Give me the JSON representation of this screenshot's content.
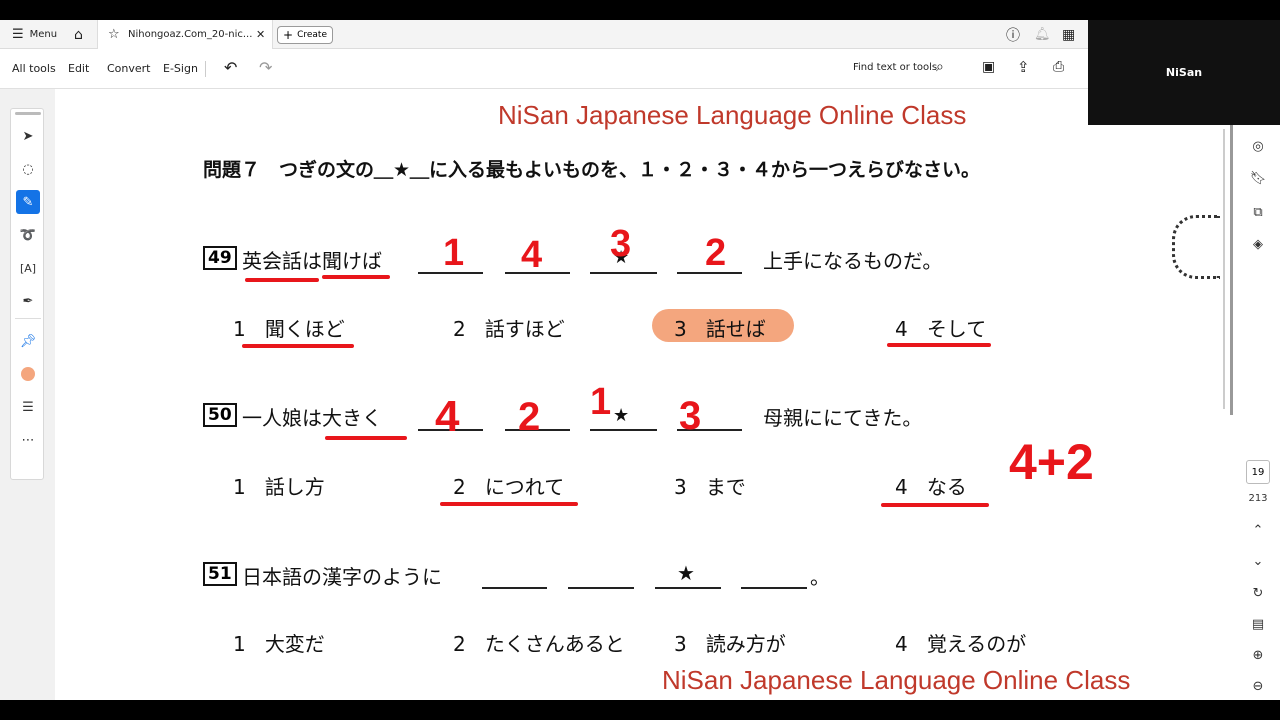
{
  "tabbar": {
    "menu_label": "Menu",
    "tab_title": "Nihongoaz.Com_20-nic...",
    "create_label": "Create"
  },
  "toolbar": {
    "all_tools": "All tools",
    "edit": "Edit",
    "convert": "Convert",
    "esign": "E-Sign",
    "find_label": "Find text or tools"
  },
  "video": {
    "name": "NiSan"
  },
  "pager": {
    "current_page": "19",
    "total_pages": "213"
  },
  "doc": {
    "watermark_top": "NiSan Japanese Language Online Class",
    "watermark_bottom": "NiSan Japanese Language Online Class",
    "instruction": "問題７　つぎの文の＿★＿に入る最もよいものを、１・２・３・４から一つえらびなさい。",
    "questions": [
      {
        "number": "49",
        "before": "英会話は聞けば",
        "star_mark": "★",
        "after": "上手になるものだ。",
        "handwritten": [
          "1",
          "4",
          "3",
          "2"
        ],
        "options": [
          {
            "num": "1",
            "text": "聞くほど"
          },
          {
            "num": "2",
            "text": "話すほど"
          },
          {
            "num": "3",
            "text": "話せば"
          },
          {
            "num": "4",
            "text": "そして"
          }
        ]
      },
      {
        "number": "50",
        "before": "一人娘は大きく",
        "star_mark": "★",
        "after": "母親ににてきた。",
        "handwritten": [
          "4",
          "2",
          "1",
          "3"
        ],
        "note": "4+2",
        "options": [
          {
            "num": "1",
            "text": "話し方"
          },
          {
            "num": "2",
            "text": "につれて"
          },
          {
            "num": "3",
            "text": "まで"
          },
          {
            "num": "4",
            "text": "なる"
          }
        ]
      },
      {
        "number": "51",
        "before": "日本語の漢字のように",
        "star_mark": "★",
        "after": "。",
        "options": [
          {
            "num": "1",
            "text": "大変だ"
          },
          {
            "num": "2",
            "text": "たくさんあると"
          },
          {
            "num": "3",
            "text": "読み方が"
          },
          {
            "num": "4",
            "text": "覚えるのが"
          }
        ]
      }
    ]
  },
  "colors": {
    "ink_red": "#e8161b",
    "highlight": "#f4a67e",
    "watermark": "#c0392b",
    "active_tool": "#1473e6"
  },
  "icons": [
    "menu-icon",
    "home-icon",
    "star-icon",
    "close-icon",
    "plus-icon",
    "help-icon",
    "bell-icon",
    "apps-icon",
    "undo-icon",
    "redo-icon",
    "search-icon",
    "save-icon",
    "upload-icon",
    "print-icon",
    "select-icon",
    "comment-icon",
    "highlight-pen-icon",
    "lasso-icon",
    "text-box-icon",
    "stamp-icon",
    "pin-icon",
    "color-dot-icon",
    "more-lines-icon",
    "ellipsis-icon"
  ]
}
